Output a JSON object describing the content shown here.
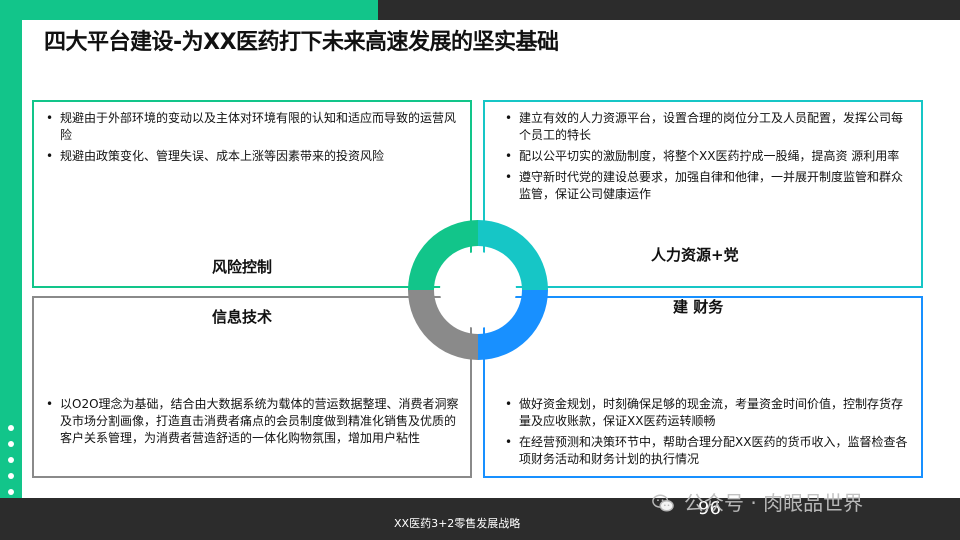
{
  "slide": {
    "title": "四大平台建设-为XX医药打下未来高速发展的坚实基础",
    "footer_text": "XX医药3+2零售发展战略",
    "page_number": "96",
    "watermark": "公众号 · 肉眼品世界"
  },
  "quadrants": {
    "risk": {
      "heading": "风险控制",
      "items": [
        "规避由于外部环境的变动以及主体对环境有限的认知和适应而导致的运营风险",
        "规避由政策变化、管理失误、成本上涨等因素带来的投资风险"
      ]
    },
    "hr": {
      "heading": "人力资源+党",
      "items": [
        "建立有效的人力资源平台，设置合理的岗位分工及人员配置，发挥公司每个员工的特长",
        "配以公平切实的激励制度，将整个XX医药拧成一股绳，提高资 源利用率",
        "遵守新时代党的建设总要求，加强自律和他律，一并展开制度监管和群众监管，保证公司健康运作"
      ]
    },
    "it": {
      "heading": "信息技术",
      "items": [
        "以O2O理念为基础，结合由大数据系统为载体的营运数据整理、消费者洞察及市场分割画像，打造直击消费者痛点的会员制度做到精准化销售及优质的客户关系管理，为消费者营造舒适的一体化购物氛围，增加用户粘性"
      ]
    },
    "finance": {
      "heading": "建 财务",
      "items": [
        "做好资金规划，时刻确保足够的现金流，考量资金时间价值，控制存货存量及应收账款，保证XX医药运转顺畅",
        "在经营预测和决策环节中，帮助合理分配XX医药的货币收入，监督检查各项财务活动和财务计划的执行情况"
      ]
    }
  },
  "colors": {
    "green": "#12c58a",
    "teal": "#16c6c6",
    "gray": "#8a8a8a",
    "blue": "#1890ff",
    "dark": "#2c2c2c"
  },
  "icons": {
    "watermark": "wechat-icon"
  }
}
